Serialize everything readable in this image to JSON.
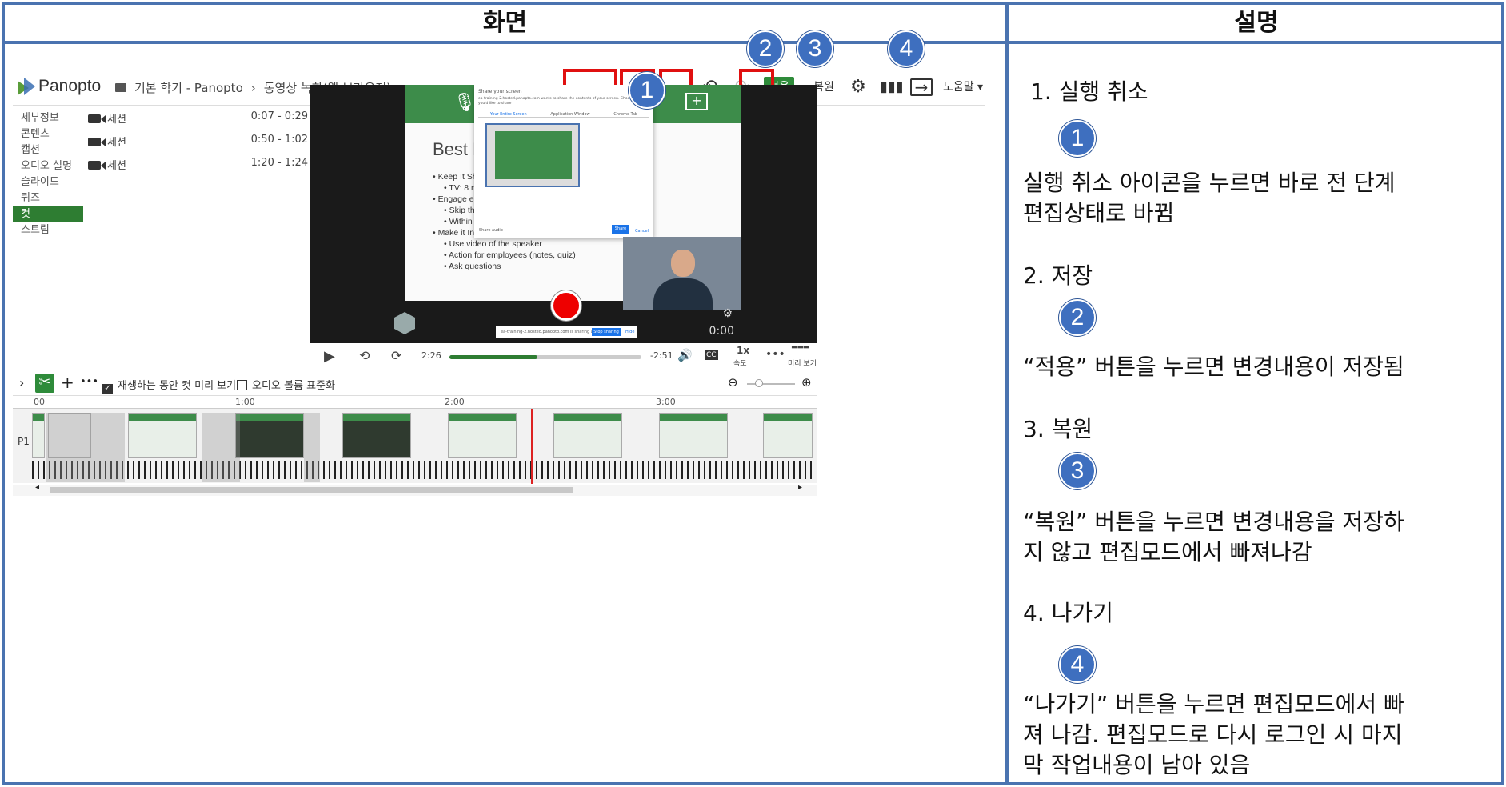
{
  "table": {
    "left_header": "화면",
    "right_header": "설명"
  },
  "app": {
    "logo_text": "Panopto",
    "breadcrumb": [
      "기본 학기 - Panopto",
      "동영상 녹화(웹 브라우저)"
    ],
    "toolbar": {
      "apply_label": "적용",
      "revert_label": "복원",
      "help_label": "도움말 ▾"
    },
    "left_nav": [
      "세부정보",
      "콘텐츠",
      "캡션",
      "오디오 설명",
      "슬라이드",
      "퀴즈",
      "컷",
      "스트림"
    ],
    "segments": [
      {
        "label": "세션",
        "time": "0:07 - 0:29"
      },
      {
        "label": "세션",
        "time": "0:50 - 1:02"
      },
      {
        "label": "세션",
        "time": "1:20 - 1:24"
      }
    ],
    "slide": {
      "title": "Best Pr",
      "bullets": [
        "• Keep It Sho",
        "• TV: 8 min",
        "• Engage ea",
        "• Skip the",
        "• Within 3",
        "• Make it Int",
        "• Use video of the speaker",
        "• Action for employees (notes, quiz)",
        "• Ask questions"
      ]
    },
    "dialog": {
      "title": "Share your screen",
      "message": "ea-training-2.hosted.panopto.com wants to share the contents of your screen. Choose what you'd like to share",
      "tabs": [
        "Your Entire Screen",
        "Application Window",
        "Chrome Tab"
      ],
      "share_audio": "Share audio",
      "share": "Share",
      "cancel": "Cancel"
    },
    "share_strip": {
      "text": "ea-training-2.hosted.panopto.com is sharing a window.",
      "stop": "Stop sharing",
      "hide": "Hide"
    },
    "video_time": "0:00",
    "controls": {
      "current": "2:26",
      "remaining": "-2:51",
      "cc": "CC",
      "speed": "1x",
      "speed_label": "속도",
      "preview_label": "미리 보기",
      "progress": 0.46
    },
    "edit_bar": {
      "preview_cuts": "재생하는 동안 컷 미리 보기",
      "normalize_audio": "오디오 볼륨 표준화"
    },
    "ruler": [
      "00",
      "1:00",
      "2:00",
      "3:00"
    ],
    "track_label": "P1"
  },
  "badges": [
    "1",
    "2",
    "3",
    "4"
  ],
  "descriptions": {
    "item1_title": "1. 실행 취소",
    "item1_text1": "실행 취소 아이콘을 누르면 바로 전 단계",
    "item1_text2": "편집상태로 바뀜",
    "item2_title": "2. 저장",
    "item2_text1": "“적용” 버튼을 누르면 변경내용이 저장됨",
    "item3_title": "3. 복원",
    "item3_text1": "“복원” 버튼을 누르면 변경내용을 저장하",
    "item3_text2": "지 않고 편집모드에서 빠져나감",
    "item4_title": "4. 나가기",
    "item4_text1": "“나가기” 버튼을 누르면 편집모드에서 빠",
    "item4_text2": "져 나감. 편집모드로 다시 로그인 시 마지",
    "item4_text3": "막 작업내용이 남아 있음"
  }
}
